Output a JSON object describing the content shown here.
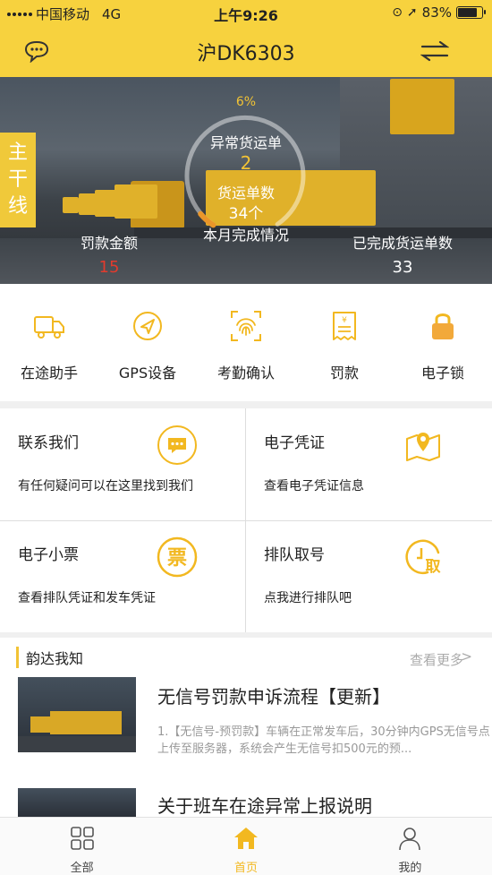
{
  "status_bar": {
    "carrier": "中国移动",
    "network": "4G",
    "time": "上午9:26",
    "battery": "83%"
  },
  "header": {
    "title": "沪DK6303",
    "message_icon": "message-icon",
    "switch_icon": "switch-arrows-icon"
  },
  "hero": {
    "side_tag": "主干线",
    "percent": "6%",
    "percent_value": 0.06,
    "abnormal_label": "异常货运单",
    "abnormal_value": "2",
    "waybill_label": "货运单数",
    "waybill_value": "34个",
    "monthly_label": "本月完成情况",
    "fine_label": "罚款金额",
    "fine_value": "15",
    "completed_label": "已完成货运单数",
    "completed_value": "33"
  },
  "actions": [
    {
      "label": "在途助手",
      "icon": "truck-icon"
    },
    {
      "label": "GPS设备",
      "icon": "gps-icon"
    },
    {
      "label": "考勤确认",
      "icon": "fingerprint-icon"
    },
    {
      "label": "罚款",
      "icon": "receipt-icon"
    },
    {
      "label": "电子锁",
      "icon": "lock-icon"
    }
  ],
  "cards": [
    {
      "title": "联系我们",
      "desc": "有任何疑问可以在这里找到我们",
      "icon": "chat-bubble-icon"
    },
    {
      "title": "电子凭证",
      "desc": "查看电子凭证信息",
      "icon": "map-pin-icon"
    },
    {
      "title": "电子小票",
      "desc": "查看排队凭证和发车凭证",
      "icon": "ticket-icon",
      "icon_text": "票"
    },
    {
      "title": "排队取号",
      "desc": "点我进行排队吧",
      "icon": "queue-clock-icon",
      "icon_text": "取"
    }
  ],
  "news": {
    "section_title": "韵达我知",
    "more_label": "查看更多",
    "more_arrow": ">",
    "items": [
      {
        "title": "无信号罚款申诉流程【更新】",
        "desc": "1.【无信号-预罚款】车辆在正常发车后，30分钟内GPS无信号点上传至服务器，系统会产生无信号扣500元的预..."
      },
      {
        "title": "关于班车在途异常上报说明",
        "desc": ""
      }
    ]
  },
  "tabbar": [
    {
      "label": "全部",
      "icon": "grid-icon"
    },
    {
      "label": "首页",
      "icon": "home-icon",
      "active": true
    },
    {
      "label": "我的",
      "icon": "profile-icon"
    }
  ],
  "colors": {
    "brand_yellow": "#f7d23e",
    "accent_gold": "#f2c335",
    "fine_red": "#e23b2d",
    "arc_orange": "#e9962a"
  }
}
